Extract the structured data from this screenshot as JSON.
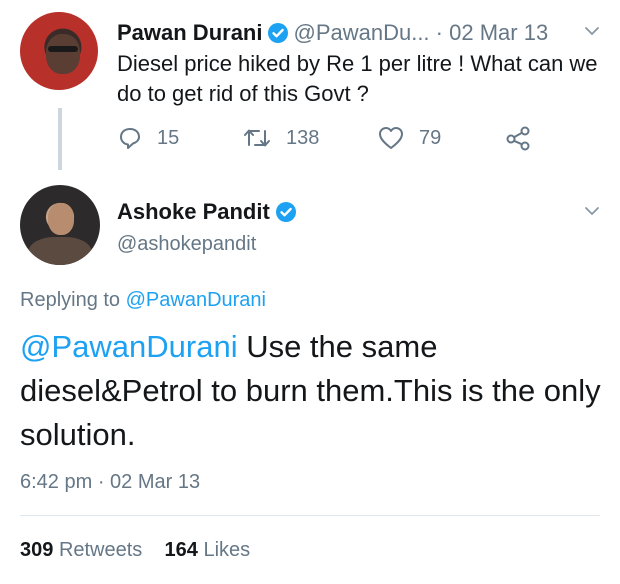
{
  "parent_tweet": {
    "name": "Pawan Durani",
    "handle": "@PawanDu...",
    "separator": "·",
    "date": "02 Mar 13",
    "text": "Diesel price hiked by Re 1 per litre ! What can we do to get rid of this Govt ?",
    "actions": {
      "reply_count": "15",
      "retweet_count": "138",
      "like_count": "79"
    },
    "verified": true
  },
  "main_tweet": {
    "name": "Ashoke Pandit",
    "handle": "@ashokepandit",
    "verified": true,
    "replying_prefix": "Replying to",
    "replying_to": "@PawanDurani",
    "mention": "@PawanDurani",
    "text": " Use the same diesel&Petrol to burn them.This is the only solution.",
    "timestamp": "6:42 pm · 02 Mar 13",
    "stats": {
      "retweets_count": "309",
      "retweets_label": "Retweets",
      "likes_count": "164",
      "likes_label": "Likes"
    }
  },
  "icons": {
    "reply": "reply-icon",
    "retweet": "retweet-icon",
    "like": "heart-icon",
    "share": "share-icon",
    "verified": "verified-badge-icon",
    "menu": "chevron-down-icon"
  },
  "colors": {
    "accent": "#1da1f2",
    "text": "#14171a",
    "muted": "#657786",
    "border": "#e1e8ed"
  }
}
